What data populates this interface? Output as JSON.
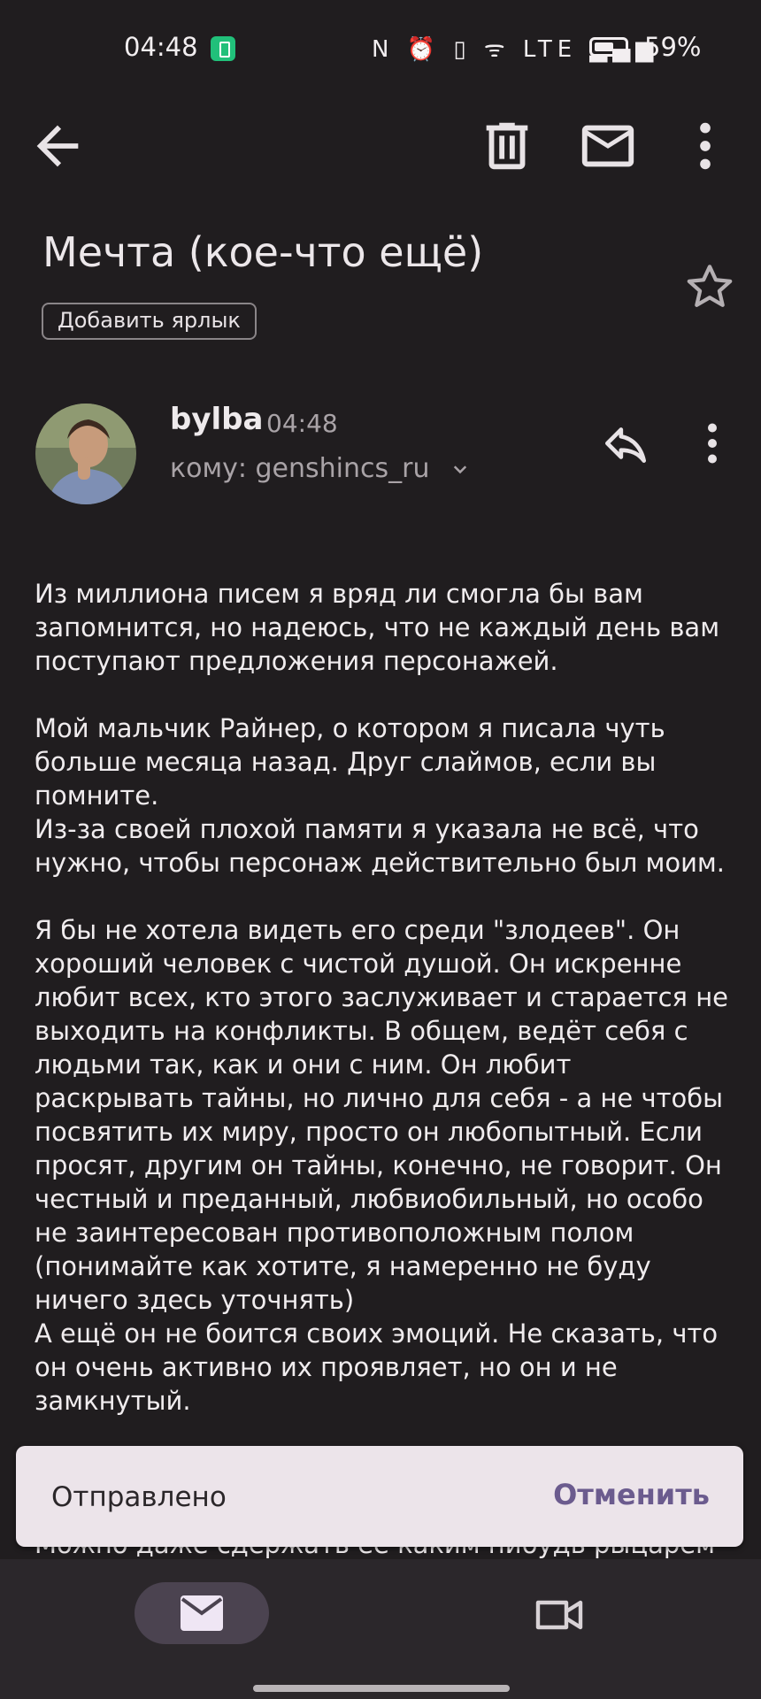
{
  "status_bar": {
    "time": "04:48",
    "icons_text": "N ⏰ ▯ ᯤ LTE ▂▄▆",
    "battery_percent": "59%",
    "battery_level": 0.59
  },
  "email": {
    "subject": "Мечта (кое-что ещё)",
    "add_label": "Добавить ярлык",
    "sender_name": "bylba",
    "sent_time": "04:48",
    "recipient": "кому: genshincs_ru",
    "body": "Из миллиона писем я вряд ли смогла бы вам\nзапомнится, но надеюсь, что не каждый день вам\nпоступают предложения персонажей.\n\nМой мальчик Райнер, о котором я писала чуть\nбольше месяца назад. Друг слаймов, если вы\nпомните.\nИз-за своей плохой памяти я указала не всё, что\nнужно, чтобы персонаж действительно был моим.\n\nЯ бы не хотела видеть его среди \"злодеев\". Он\nхороший человек с чистой душой. Он искренне\nлюбит всех, кто этого заслуживает и старается не\nвыходить на конфликты. В общем, ведёт себя с\nлюдьми так, как и они с ним. Он любит\nраскрывать тайны, но лично для себя - а не чтобы\nпосвятить их миру, просто он любопытный. Если\nпросят, другим он тайны, конечно, не говорит. Он\nчестный и преданный, любвиобильный, но особо\nне заинтересован противоположным полом\n(понимайте как хотите, я намеренно не буду\nничего здесь уточнять)\nА ещё он не боится своих эмоций. Не сказать, что\nон очень активно их проявляет, но он и не\nзамкнутый.",
    "body_tail": "Можно даже сдержать ее каким нибудь рыцарем"
  },
  "snackbar": {
    "message": "Отправлено",
    "action": "Отменить"
  },
  "colors": {
    "background": "#201d1f",
    "accent": "#6b5b8e",
    "snackbar": "#ece4ea",
    "nav_active": "#4b4350"
  },
  "icons": [
    "back-arrow-icon",
    "trash-icon",
    "mail-icon",
    "more-vert-icon",
    "star-icon",
    "reply-icon",
    "chevron-down-icon",
    "meet-video-icon"
  ]
}
